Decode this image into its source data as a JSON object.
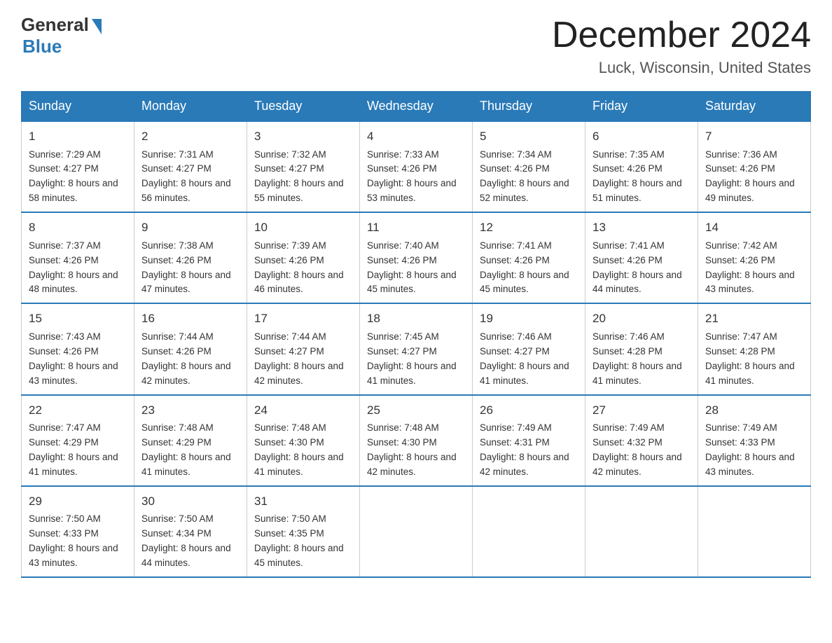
{
  "header": {
    "logo_general": "General",
    "logo_blue": "Blue",
    "month_title": "December 2024",
    "location": "Luck, Wisconsin, United States"
  },
  "weekdays": [
    "Sunday",
    "Monday",
    "Tuesday",
    "Wednesday",
    "Thursday",
    "Friday",
    "Saturday"
  ],
  "weeks": [
    [
      {
        "day": "1",
        "sunrise": "7:29 AM",
        "sunset": "4:27 PM",
        "daylight": "8 hours and 58 minutes."
      },
      {
        "day": "2",
        "sunrise": "7:31 AM",
        "sunset": "4:27 PM",
        "daylight": "8 hours and 56 minutes."
      },
      {
        "day": "3",
        "sunrise": "7:32 AM",
        "sunset": "4:27 PM",
        "daylight": "8 hours and 55 minutes."
      },
      {
        "day": "4",
        "sunrise": "7:33 AM",
        "sunset": "4:26 PM",
        "daylight": "8 hours and 53 minutes."
      },
      {
        "day": "5",
        "sunrise": "7:34 AM",
        "sunset": "4:26 PM",
        "daylight": "8 hours and 52 minutes."
      },
      {
        "day": "6",
        "sunrise": "7:35 AM",
        "sunset": "4:26 PM",
        "daylight": "8 hours and 51 minutes."
      },
      {
        "day": "7",
        "sunrise": "7:36 AM",
        "sunset": "4:26 PM",
        "daylight": "8 hours and 49 minutes."
      }
    ],
    [
      {
        "day": "8",
        "sunrise": "7:37 AM",
        "sunset": "4:26 PM",
        "daylight": "8 hours and 48 minutes."
      },
      {
        "day": "9",
        "sunrise": "7:38 AM",
        "sunset": "4:26 PM",
        "daylight": "8 hours and 47 minutes."
      },
      {
        "day": "10",
        "sunrise": "7:39 AM",
        "sunset": "4:26 PM",
        "daylight": "8 hours and 46 minutes."
      },
      {
        "day": "11",
        "sunrise": "7:40 AM",
        "sunset": "4:26 PM",
        "daylight": "8 hours and 45 minutes."
      },
      {
        "day": "12",
        "sunrise": "7:41 AM",
        "sunset": "4:26 PM",
        "daylight": "8 hours and 45 minutes."
      },
      {
        "day": "13",
        "sunrise": "7:41 AM",
        "sunset": "4:26 PM",
        "daylight": "8 hours and 44 minutes."
      },
      {
        "day": "14",
        "sunrise": "7:42 AM",
        "sunset": "4:26 PM",
        "daylight": "8 hours and 43 minutes."
      }
    ],
    [
      {
        "day": "15",
        "sunrise": "7:43 AM",
        "sunset": "4:26 PM",
        "daylight": "8 hours and 43 minutes."
      },
      {
        "day": "16",
        "sunrise": "7:44 AM",
        "sunset": "4:26 PM",
        "daylight": "8 hours and 42 minutes."
      },
      {
        "day": "17",
        "sunrise": "7:44 AM",
        "sunset": "4:27 PM",
        "daylight": "8 hours and 42 minutes."
      },
      {
        "day": "18",
        "sunrise": "7:45 AM",
        "sunset": "4:27 PM",
        "daylight": "8 hours and 41 minutes."
      },
      {
        "day": "19",
        "sunrise": "7:46 AM",
        "sunset": "4:27 PM",
        "daylight": "8 hours and 41 minutes."
      },
      {
        "day": "20",
        "sunrise": "7:46 AM",
        "sunset": "4:28 PM",
        "daylight": "8 hours and 41 minutes."
      },
      {
        "day": "21",
        "sunrise": "7:47 AM",
        "sunset": "4:28 PM",
        "daylight": "8 hours and 41 minutes."
      }
    ],
    [
      {
        "day": "22",
        "sunrise": "7:47 AM",
        "sunset": "4:29 PM",
        "daylight": "8 hours and 41 minutes."
      },
      {
        "day": "23",
        "sunrise": "7:48 AM",
        "sunset": "4:29 PM",
        "daylight": "8 hours and 41 minutes."
      },
      {
        "day": "24",
        "sunrise": "7:48 AM",
        "sunset": "4:30 PM",
        "daylight": "8 hours and 41 minutes."
      },
      {
        "day": "25",
        "sunrise": "7:48 AM",
        "sunset": "4:30 PM",
        "daylight": "8 hours and 42 minutes."
      },
      {
        "day": "26",
        "sunrise": "7:49 AM",
        "sunset": "4:31 PM",
        "daylight": "8 hours and 42 minutes."
      },
      {
        "day": "27",
        "sunrise": "7:49 AM",
        "sunset": "4:32 PM",
        "daylight": "8 hours and 42 minutes."
      },
      {
        "day": "28",
        "sunrise": "7:49 AM",
        "sunset": "4:33 PM",
        "daylight": "8 hours and 43 minutes."
      }
    ],
    [
      {
        "day": "29",
        "sunrise": "7:50 AM",
        "sunset": "4:33 PM",
        "daylight": "8 hours and 43 minutes."
      },
      {
        "day": "30",
        "sunrise": "7:50 AM",
        "sunset": "4:34 PM",
        "daylight": "8 hours and 44 minutes."
      },
      {
        "day": "31",
        "sunrise": "7:50 AM",
        "sunset": "4:35 PM",
        "daylight": "8 hours and 45 minutes."
      },
      null,
      null,
      null,
      null
    ]
  ],
  "labels": {
    "sunrise": "Sunrise:",
    "sunset": "Sunset:",
    "daylight": "Daylight:"
  }
}
